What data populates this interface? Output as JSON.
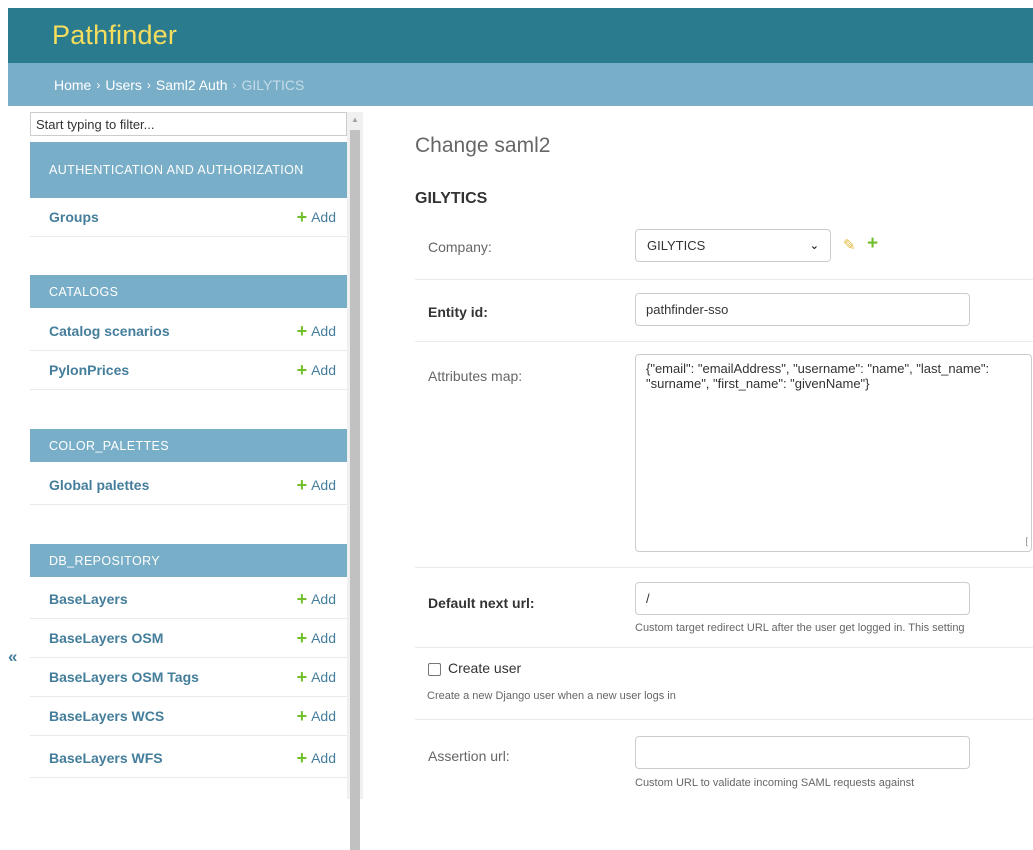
{
  "header": {
    "brand": "Pathfinder"
  },
  "breadcrumbs": {
    "home": "Home",
    "users": "Users",
    "section": "Saml2 Auth",
    "current": "GILYTICS",
    "separator": "›"
  },
  "sidebar": {
    "filter_placeholder": "Start typing to filter...",
    "add_label": "Add",
    "collapse_glyph": "«",
    "modules": [
      {
        "title": "AUTHENTICATION AND AUTHORIZATION",
        "models": [
          "Groups"
        ]
      },
      {
        "title": "CATALOGS",
        "models": [
          "Catalog scenarios",
          "PylonPrices"
        ]
      },
      {
        "title": "COLOR_PALETTES",
        "models": [
          "Global palettes"
        ]
      },
      {
        "title": "DB_REPOSITORY",
        "models": [
          "BaseLayers",
          "BaseLayers OSM",
          "BaseLayers OSM Tags",
          "BaseLayers WCS",
          "BaseLayers WFS"
        ]
      }
    ]
  },
  "main": {
    "title": "Change saml2",
    "object_name": "GILYTICS",
    "company": {
      "label": "Company:",
      "value": "GILYTICS"
    },
    "entity_id": {
      "label": "Entity id:",
      "value": "pathfinder-sso"
    },
    "attributes_map": {
      "label": "Attributes map:",
      "value": "{\"email\": \"emailAddress\", \"username\": \"name\", \"last_name\": \"surname\", \"first_name\": \"givenName\"}"
    },
    "default_next_url": {
      "label": "Default next url:",
      "value": "/",
      "help": "Custom target redirect URL after the user get logged in. This setting"
    },
    "create_user": {
      "label": "Create user",
      "checked": false,
      "help": "Create a new Django user when a new user logs in"
    },
    "assertion_url": {
      "label": "Assertion url:",
      "value": "",
      "help": "Custom URL to validate incoming SAML requests against"
    }
  }
}
